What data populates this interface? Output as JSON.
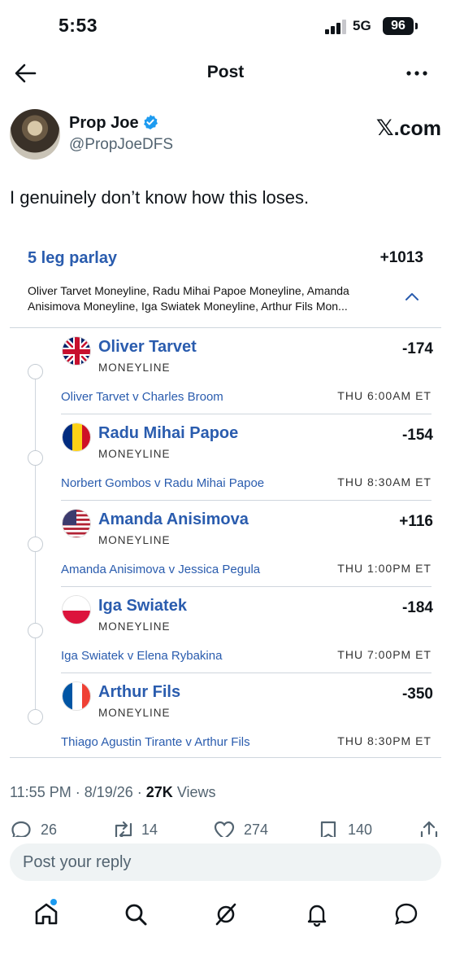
{
  "status_bar": {
    "time": "5:53",
    "network": "5G",
    "battery": "96"
  },
  "nav": {
    "title": "Post",
    "back_icon": "arrow-left-icon",
    "more_icon": "more-horizontal-icon"
  },
  "author": {
    "name": "Prop Joe",
    "handle": "@PropJoeDFS",
    "source": ".com",
    "source_mark": "𝕏",
    "verified_color": "#1d9bf0"
  },
  "post": {
    "text": "I genuinely don’t know how this loses."
  },
  "parlay": {
    "title": "5 leg parlay",
    "odds": "+1013",
    "description": "Oliver Tarvet Moneyline, Radu Mihai Papoe Moneyline, Amanda Anisimova Moneyline, Iga Swiatek Moneyline, Arthur Fils Mon...",
    "legs": [
      {
        "name": "Oliver Tarvet",
        "market": "MONEYLINE",
        "odds": "-174",
        "match": "Oliver Tarvet v Charles Broom",
        "time": "THU 6:00AM ET",
        "flag": "gb-flag-icon"
      },
      {
        "name": "Radu Mihai Papoe",
        "market": "MONEYLINE",
        "odds": "-154",
        "match": "Norbert Gombos v Radu Mihai Papoe",
        "time": "THU 8:30AM ET",
        "flag": "ro-flag-icon"
      },
      {
        "name": "Amanda Anisimova",
        "market": "MONEYLINE",
        "odds": "+116",
        "match": "Amanda Anisimova v Jessica Pegula",
        "time": "THU 1:00PM ET",
        "flag": "us-flag-icon"
      },
      {
        "name": "Iga Swiatek",
        "market": "MONEYLINE",
        "odds": "-184",
        "match": "Iga Swiatek v Elena Rybakina",
        "time": "THU 7:00PM ET",
        "flag": "pl-flag-icon"
      },
      {
        "name": "Arthur Fils",
        "market": "MONEYLINE",
        "odds": "-350",
        "match": "Thiago Agustin Tirante v Arthur Fils",
        "time": "THU 8:30PM ET",
        "flag": "fr-flag-icon"
      }
    ]
  },
  "meta": {
    "time": "11:55 PM",
    "sep1": " · ",
    "date": "8/19/26",
    "sep2": " · ",
    "views_count": "27K",
    "views_label": " Views"
  },
  "actions": {
    "replies": "26",
    "reposts": "14",
    "likes": "274",
    "bookmarks": "140"
  },
  "reply": {
    "placeholder": "Post your reply"
  },
  "colors": {
    "accent": "#2a5cae",
    "muted": "#536471",
    "link_blue": "#1d9bf0"
  }
}
